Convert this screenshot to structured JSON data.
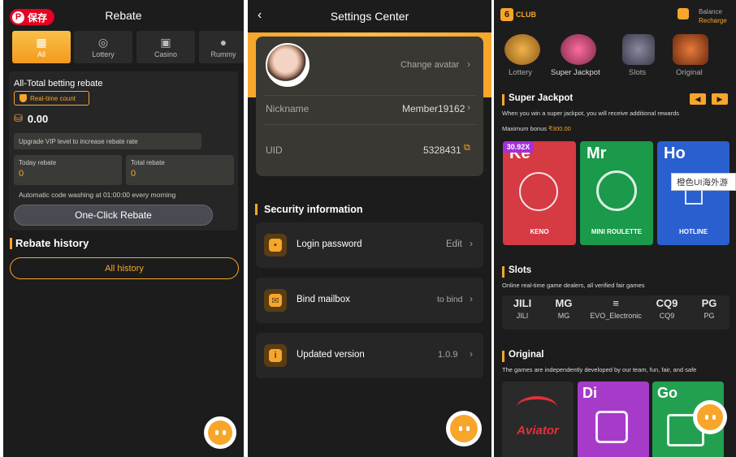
{
  "rebate": {
    "pin_label": "保存",
    "title": "Rebate",
    "tabs": [
      {
        "label": "All",
        "icon": "grid-icon"
      },
      {
        "label": "Lottery",
        "icon": "lottery-ball-icon"
      },
      {
        "label": "Casino",
        "icon": "casino-icon"
      },
      {
        "label": "Rummy",
        "icon": "rummy-icon"
      }
    ],
    "card_title": "All-Total betting rebate",
    "realtime_label": "Real-time count",
    "amount": "0.00",
    "upgrade_text": "Upgrade VIP level to increase rebate rate",
    "today_label": "Today rebate",
    "today_value": "0",
    "total_label": "Total rebate",
    "total_value": "0",
    "auto_text": "Automatic code washing at 01:00:00 every morning",
    "oneclick_label": "One-Click Rebate",
    "history_title": "Rebate history",
    "all_history_label": "All history"
  },
  "settings": {
    "title": "Settings Center",
    "change_avatar": "Change avatar",
    "nickname_label": "Nickname",
    "nickname_value": "Member19162",
    "uid_label": "UID",
    "uid_value": "5328431",
    "security_title": "Security information",
    "items": [
      {
        "label": "Login password",
        "value": "Edit",
        "icon": "lock-icon"
      },
      {
        "label": "Bind mailbox",
        "value": "to bind",
        "icon": "mail-icon"
      },
      {
        "label": "Updated version",
        "value": "1.0.9",
        "icon": "info-icon"
      }
    ]
  },
  "home": {
    "brand": "CLUB",
    "balance_label": "Balance",
    "recharge_label": "Recharge",
    "categories": [
      "Lottery",
      "Super Jackpot",
      "Slots",
      "Original"
    ],
    "jackpot_title": "Super Jackpot",
    "jackpot_desc": "When you win a super jackpot, you will receive additional rewards",
    "max_bonus_label": "Maximum bonus",
    "max_bonus_value": "₹300.00",
    "multiplier_badge": "30.92X",
    "jackpot_games": [
      {
        "title": "Ke",
        "name": "KENO",
        "color": "#d63a43"
      },
      {
        "title": "Mr",
        "name": "MINI ROULETTE",
        "color": "#1a9a4a"
      },
      {
        "title": "Ho",
        "name": "HOTLINE",
        "color": "#2a5fcf"
      }
    ],
    "tooltip": "橙色UI海外游",
    "slots_title": "Slots",
    "slots_desc": "Online real-time game dealers, all verified fair games",
    "providers": [
      {
        "logo": "JILI",
        "name": "JILI"
      },
      {
        "logo": "MG",
        "name": "MG"
      },
      {
        "logo": "≡",
        "name": "EVO_Electronic"
      },
      {
        "logo": "CQ9",
        "name": "CQ9"
      },
      {
        "logo": "PG",
        "name": "PG"
      }
    ],
    "original_title": "Original",
    "original_desc": "The games are independently developed by our team, fun, fair, and safe",
    "original_games": [
      {
        "title": "",
        "name": "Aviator",
        "color": "#2a2a2a"
      },
      {
        "title": "Di",
        "name": "",
        "color": "#a63bc9"
      },
      {
        "title": "Go",
        "name": "",
        "color": "#22a050"
      }
    ]
  }
}
